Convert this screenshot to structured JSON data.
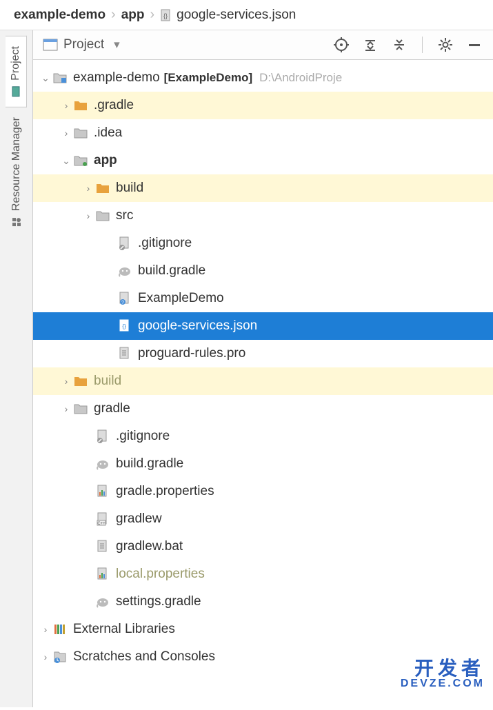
{
  "breadcrumb": {
    "root": "example-demo",
    "mid": "app",
    "file": "google-services.json"
  },
  "sidebar": {
    "tabs": [
      "Project",
      "Resource Manager"
    ]
  },
  "toolbar": {
    "title": "Project"
  },
  "tree": {
    "root": {
      "name": "example-demo",
      "bracket": "[ExampleDemo]",
      "path": "D:\\AndroidProje"
    },
    "items": [
      {
        "ind": 1,
        "arrow": "right",
        "icon": "folder-orange",
        "label": ".gradle",
        "hl": true
      },
      {
        "ind": 1,
        "arrow": "right",
        "icon": "folder-grey",
        "label": ".idea"
      },
      {
        "ind": 1,
        "arrow": "down",
        "icon": "folder-grey-dot",
        "label": "app",
        "bold": true
      },
      {
        "ind": 2,
        "arrow": "right",
        "icon": "folder-orange",
        "label": "build",
        "hl": true
      },
      {
        "ind": 2,
        "arrow": "right",
        "icon": "folder-grey",
        "label": "src"
      },
      {
        "ind": 3,
        "arrow": "",
        "icon": "file-ignore",
        "label": ".gitignore"
      },
      {
        "ind": 3,
        "arrow": "",
        "icon": "gradle",
        "label": "build.gradle"
      },
      {
        "ind": 3,
        "arrow": "",
        "icon": "file-q",
        "label": "ExampleDemo"
      },
      {
        "ind": 3,
        "arrow": "",
        "icon": "file-json",
        "label": "google-services.json",
        "sel": true
      },
      {
        "ind": 3,
        "arrow": "",
        "icon": "file-text",
        "label": "proguard-rules.pro"
      },
      {
        "ind": 1,
        "arrow": "right",
        "icon": "folder-orange",
        "label": "build",
        "hl": true,
        "dim": true
      },
      {
        "ind": 1,
        "arrow": "right",
        "icon": "folder-grey",
        "label": "gradle"
      },
      {
        "ind": 2,
        "arrow": "",
        "icon": "file-ignore",
        "label": ".gitignore"
      },
      {
        "ind": 2,
        "arrow": "",
        "icon": "gradle",
        "label": "build.gradle"
      },
      {
        "ind": 2,
        "arrow": "",
        "icon": "file-props",
        "label": "gradle.properties"
      },
      {
        "ind": 2,
        "arrow": "",
        "icon": "file-cpp",
        "label": "gradlew"
      },
      {
        "ind": 2,
        "arrow": "",
        "icon": "file-text",
        "label": "gradlew.bat"
      },
      {
        "ind": 2,
        "arrow": "",
        "icon": "file-props",
        "label": "local.properties",
        "dim": true
      },
      {
        "ind": 2,
        "arrow": "",
        "icon": "gradle",
        "label": "settings.gradle"
      }
    ],
    "extlib": "External Libraries",
    "scratch": "Scratches and Consoles"
  },
  "watermark": {
    "l1": "开发者",
    "l2": "DEVZE.COM"
  }
}
